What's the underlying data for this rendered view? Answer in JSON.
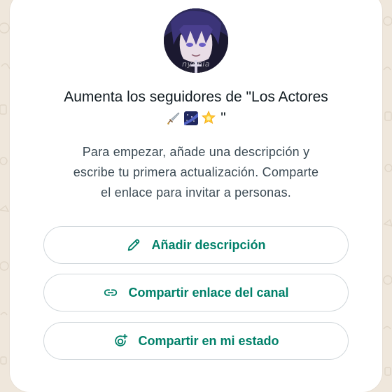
{
  "channel": {
    "avatar_alt": "channel-avatar",
    "title_line1": "Aumenta los seguidores de \"Los Actores",
    "title_emojis": [
      "dagger-emoji",
      "milky-way-emoji",
      "glowing-star-emoji"
    ],
    "title_close_quote": "\"",
    "description_line1": "Para empezar, añade una descripción y",
    "description_line2": "escribe tu primera actualización. Comparte",
    "description_line3": "el enlace para invitar a personas."
  },
  "actions": {
    "add_description": {
      "label": "Añadir descripción",
      "icon": "pencil-icon"
    },
    "share_link": {
      "label": "Compartir enlace del canal",
      "icon": "link-icon"
    },
    "share_status": {
      "label": "Compartir en mi estado",
      "icon": "status-add-icon"
    }
  },
  "colors": {
    "accent": "#008069",
    "title": "#111b21",
    "body_text": "#3b4a54",
    "button_border": "#d1d7db",
    "wallpaper": "#efe7dc"
  }
}
